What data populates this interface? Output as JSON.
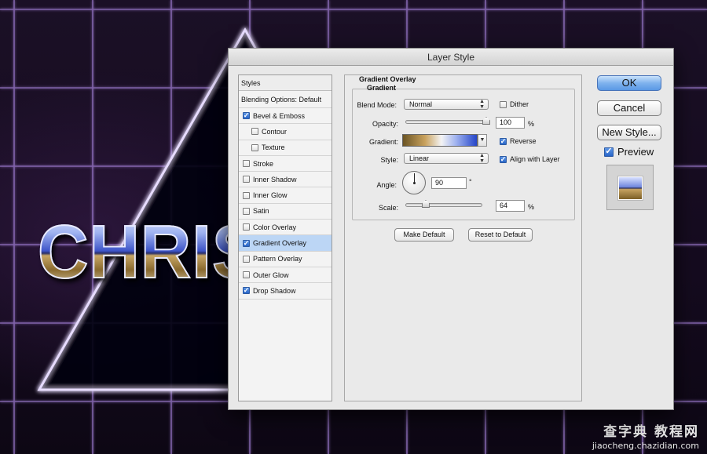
{
  "dialog": {
    "title": "Layer Style"
  },
  "background": {
    "text": "CHRIS",
    "watermark_line1": "查字典 教程网",
    "watermark_line2": "jiaocheng.chazidian.com"
  },
  "styles_panel": {
    "header": "Styles",
    "blending_options": "Blending Options: Default",
    "items": [
      {
        "label": "Bevel & Emboss",
        "checked": true,
        "indent": false,
        "selected": false
      },
      {
        "label": "Contour",
        "checked": false,
        "indent": true,
        "selected": false
      },
      {
        "label": "Texture",
        "checked": false,
        "indent": true,
        "selected": false
      },
      {
        "label": "Stroke",
        "checked": false,
        "indent": false,
        "selected": false
      },
      {
        "label": "Inner Shadow",
        "checked": false,
        "indent": false,
        "selected": false
      },
      {
        "label": "Inner Glow",
        "checked": false,
        "indent": false,
        "selected": false
      },
      {
        "label": "Satin",
        "checked": false,
        "indent": false,
        "selected": false
      },
      {
        "label": "Color Overlay",
        "checked": false,
        "indent": false,
        "selected": false
      },
      {
        "label": "Gradient Overlay",
        "checked": true,
        "indent": false,
        "selected": true
      },
      {
        "label": "Pattern Overlay",
        "checked": false,
        "indent": false,
        "selected": false
      },
      {
        "label": "Outer Glow",
        "checked": false,
        "indent": false,
        "selected": false
      },
      {
        "label": "Drop Shadow",
        "checked": true,
        "indent": false,
        "selected": false
      }
    ]
  },
  "gradient_overlay": {
    "group_title": "Gradient Overlay",
    "subgroup_title": "Gradient",
    "blend_mode_label": "Blend Mode:",
    "blend_mode_value": "Normal",
    "dither_label": "Dither",
    "dither_checked": false,
    "opacity_label": "Opacity:",
    "opacity_value": "100",
    "opacity_fraction": 1.0,
    "percent": "%",
    "gradient_label": "Gradient:",
    "reverse_label": "Reverse",
    "reverse_checked": true,
    "style_label": "Style:",
    "style_value": "Linear",
    "align_label": "Align with Layer",
    "align_checked": true,
    "angle_label": "Angle:",
    "angle_value": "90",
    "degree": "°",
    "scale_label": "Scale:",
    "scale_value": "64",
    "scale_fraction": 0.26,
    "make_default": "Make Default",
    "reset_default": "Reset to Default"
  },
  "actions": {
    "ok": "OK",
    "cancel": "Cancel",
    "new_style": "New Style...",
    "preview_label": "Preview",
    "preview_checked": true
  },
  "colors": {
    "selected_row": "#bcd6f5",
    "checkbox_on": "#2865c8",
    "ok_button": "#5a97e4",
    "neon": "#c9b4ff"
  }
}
